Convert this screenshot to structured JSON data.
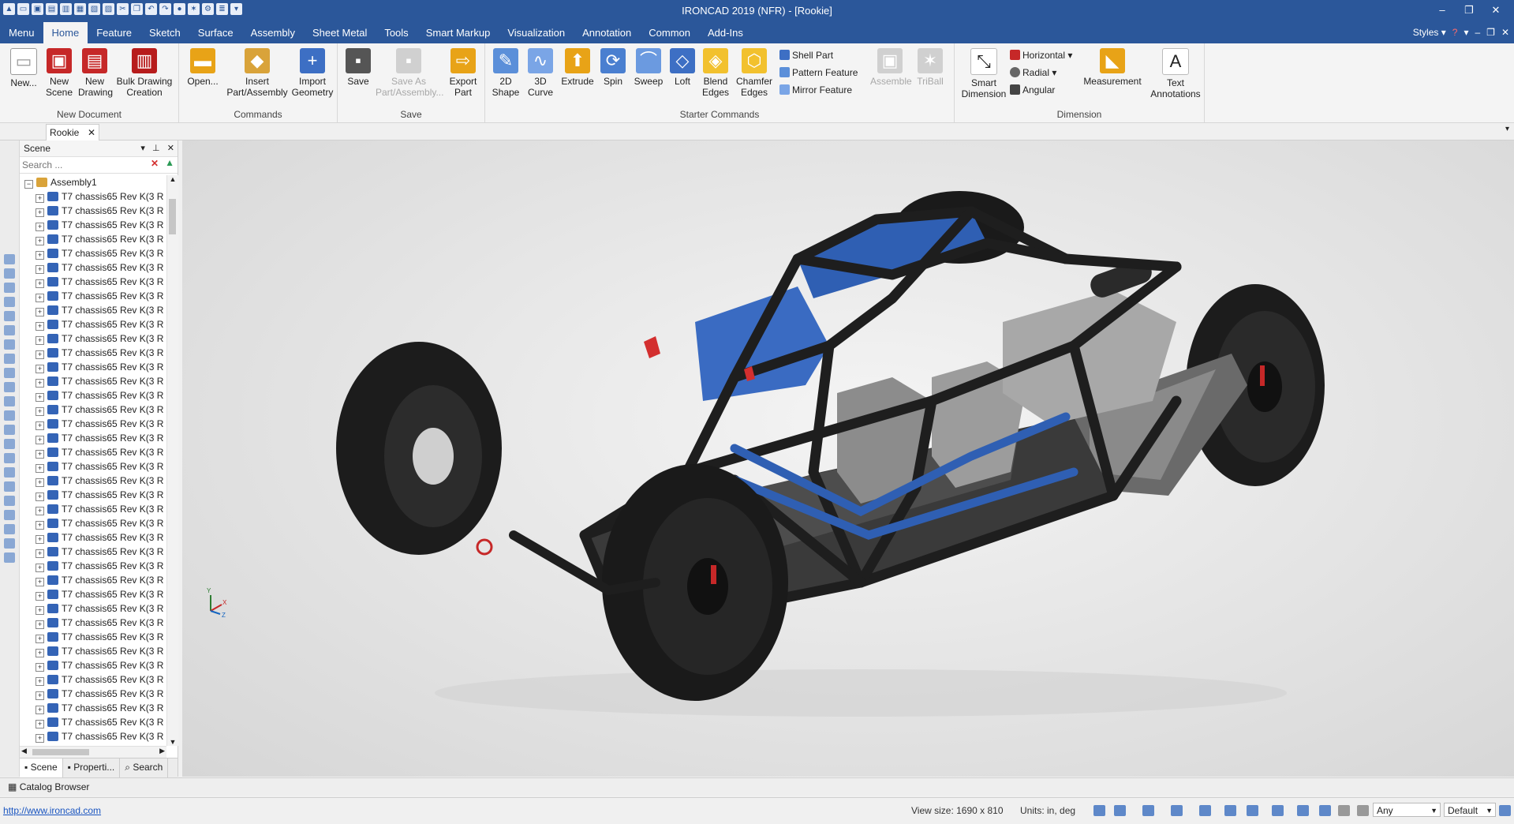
{
  "app": {
    "title": "IRONCAD 2019 (NFR) - [Rookie]",
    "styles_label": "Styles"
  },
  "menu_tabs": [
    "Menu",
    "Home",
    "Feature",
    "Sketch",
    "Surface",
    "Assembly",
    "Sheet Metal",
    "Tools",
    "Smart Markup",
    "Visualization",
    "Annotation",
    "Common",
    "Add-Ins"
  ],
  "active_tab": "Home",
  "ribbon": {
    "groups": {
      "new_document": "New Document",
      "commands": "Commands",
      "save": "Save",
      "starter": "Starter Commands",
      "dimension": "Dimension"
    },
    "buttons": {
      "new": "New...",
      "new_scene": "New\nScene",
      "new_drawing": "New\nDrawing",
      "bulk_drawing": "Bulk Drawing\nCreation",
      "open": "Open...",
      "insert": "Insert\nPart/Assembly",
      "import": "Import\nGeometry",
      "save": "Save",
      "save_as": "Save As\nPart/Assembly...",
      "export": "Export\nPart",
      "shape2d": "2D\nShape",
      "curve3d": "3D\nCurve",
      "extrude": "Extrude",
      "spin": "Spin",
      "sweep": "Sweep",
      "loft": "Loft",
      "blend": "Blend\nEdges",
      "chamfer": "Chamfer\nEdges",
      "shell": "Shell Part",
      "pattern": "Pattern Feature",
      "mirror": "Mirror Feature",
      "assemble": "Assemble",
      "triball": "TriBall",
      "smart_dim": "Smart\nDimension",
      "horizontal": "Horizontal",
      "radial": "Radial",
      "angular": "Angular",
      "measurement": "Measurement",
      "text_ann": "Text\nAnnotations"
    }
  },
  "doc_tab": "Rookie",
  "scene_panel": {
    "title": "Scene",
    "search_placeholder": "Search ...",
    "root": "Assembly1",
    "item_label": "T7 chassis65 Rev K(3 R",
    "item_count": 39,
    "tabs": [
      "Scene",
      "Properti...",
      "Search"
    ]
  },
  "catalog_browser": "Catalog Browser",
  "status": {
    "url": "http://www.ironcad.com",
    "view_size": "View size: 1690 x  810",
    "units": "Units: in, deg",
    "filter_value": "Any",
    "style_value": "Default"
  },
  "colors": {
    "title_bar": "#2b579a",
    "frame_blue": "#2f5fb3",
    "tube_black": "#1e1e1e"
  }
}
